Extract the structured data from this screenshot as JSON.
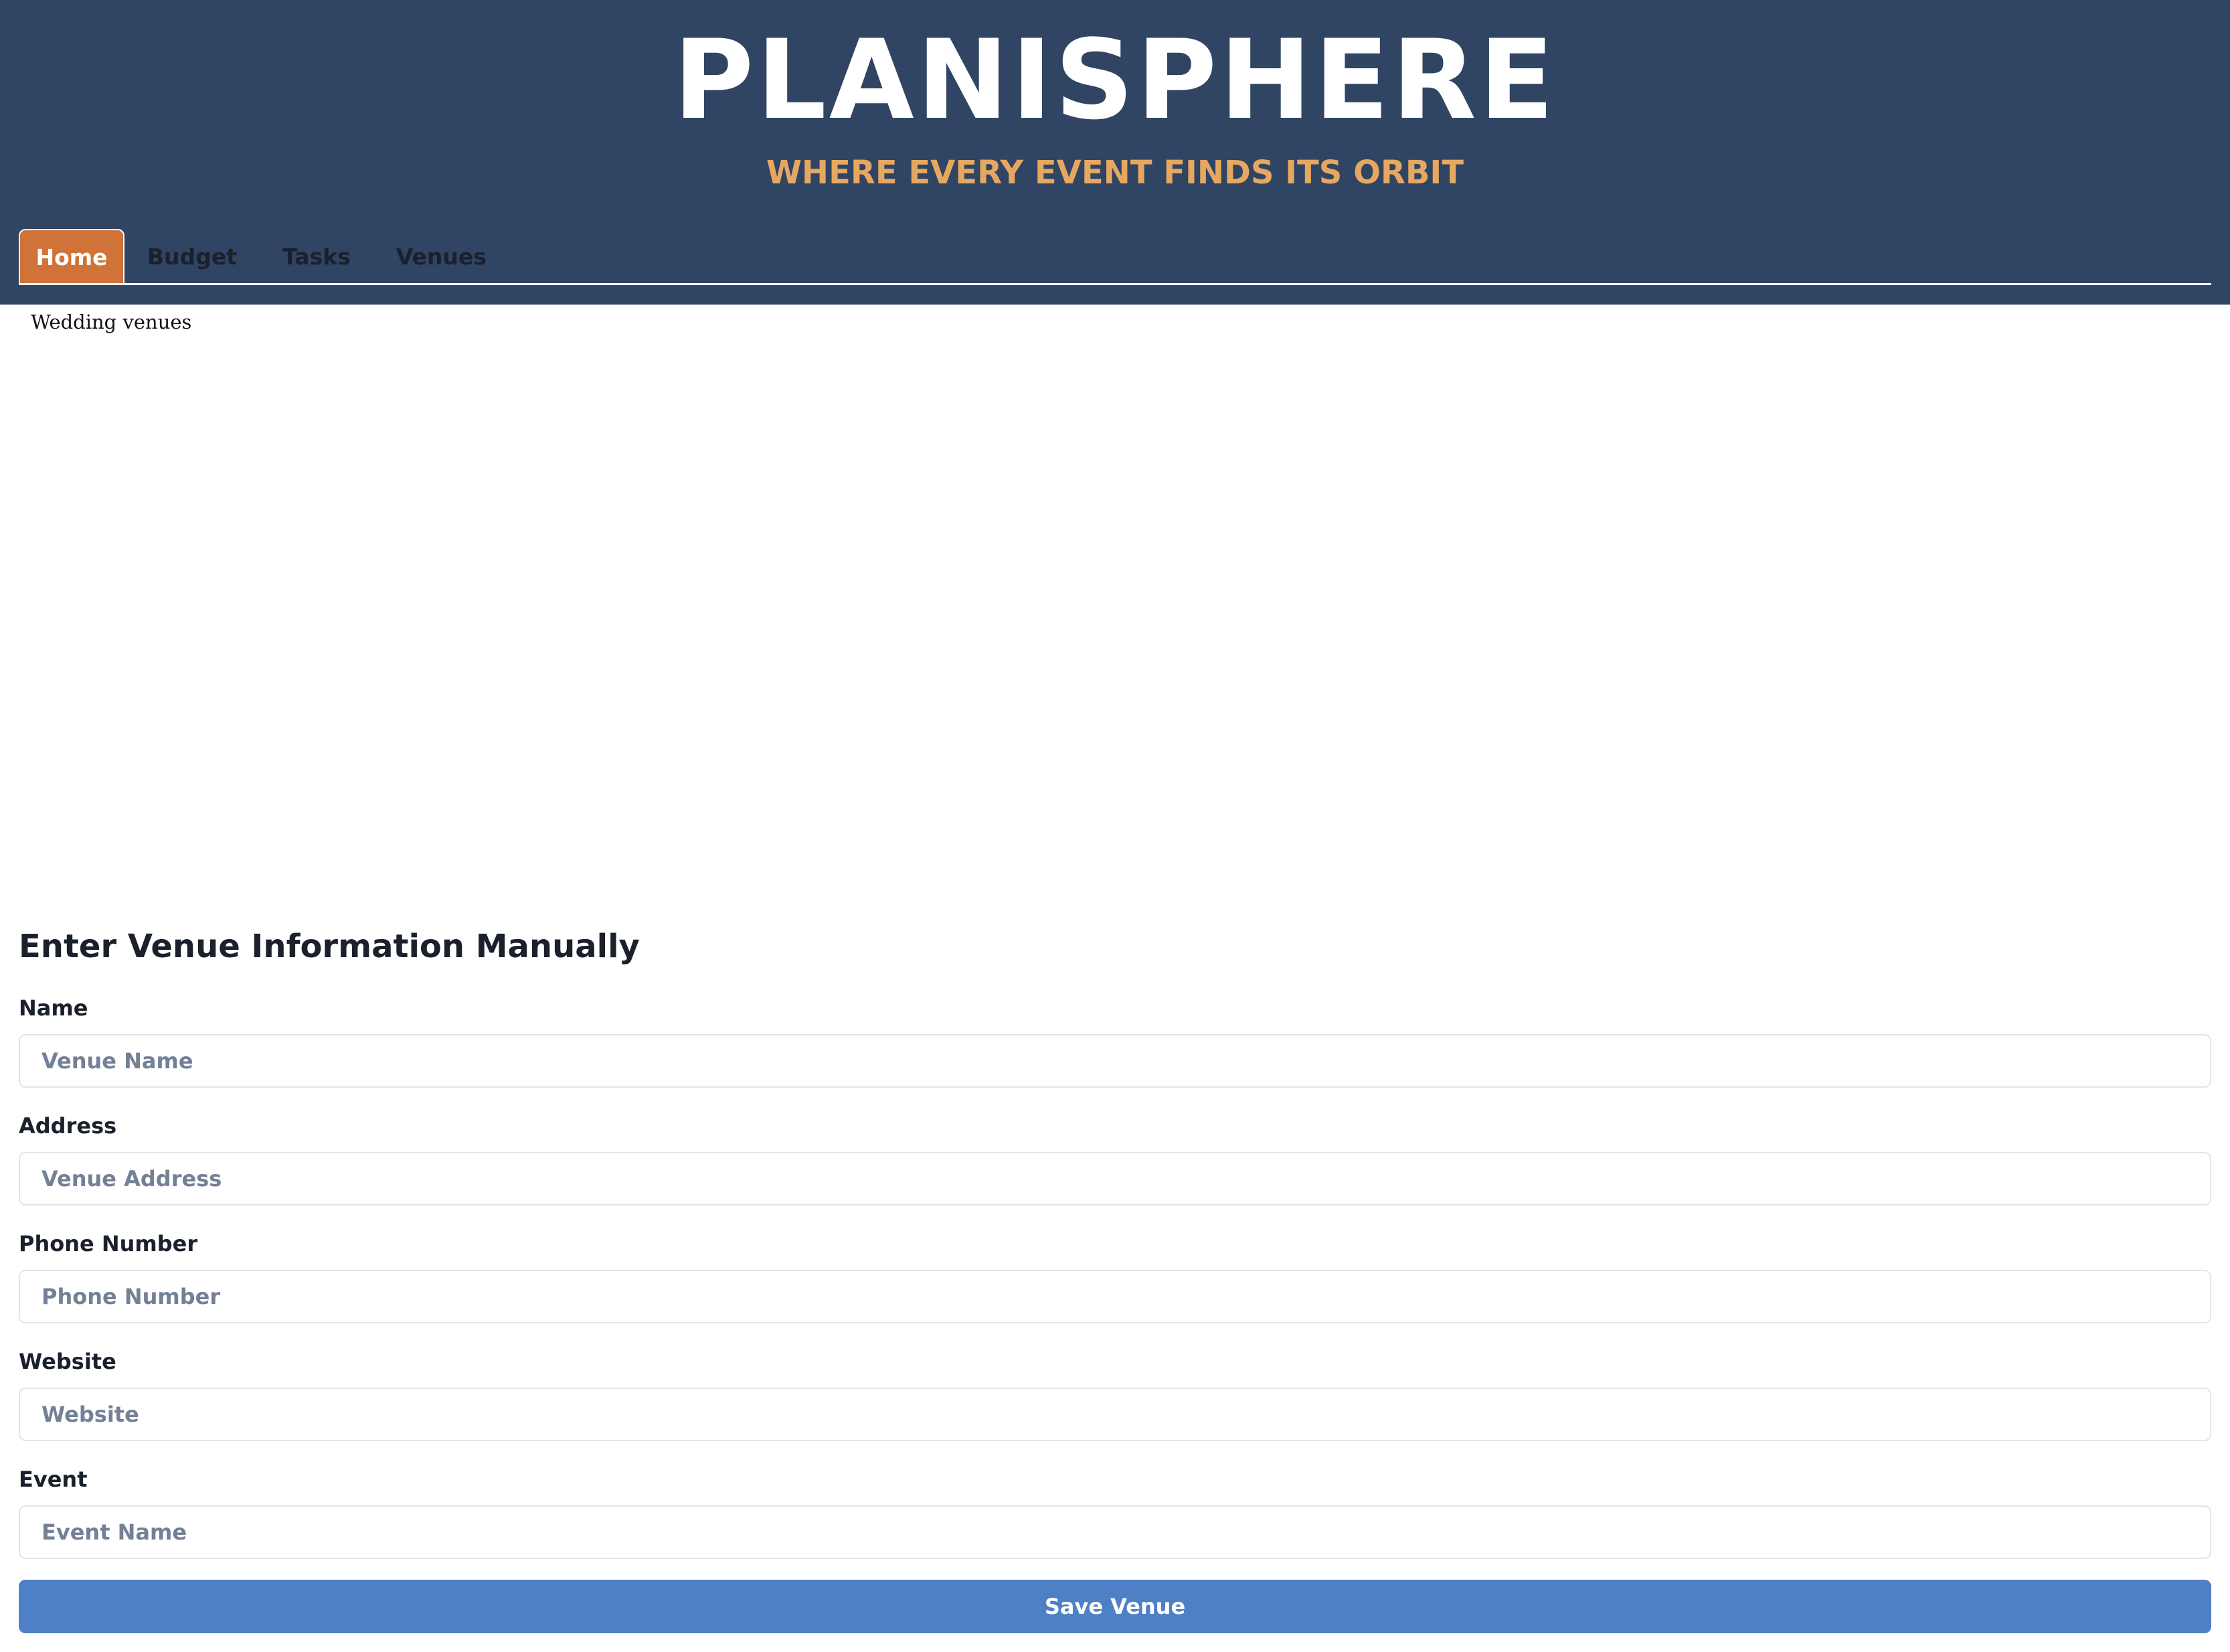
{
  "header": {
    "title": "PLANISPHERE",
    "subtitle": "WHERE EVERY EVENT FINDS ITS ORBIT"
  },
  "tabs": [
    {
      "label": "Home",
      "active": true
    },
    {
      "label": "Budget",
      "active": false
    },
    {
      "label": "Tasks",
      "active": false
    },
    {
      "label": "Venues",
      "active": false
    }
  ],
  "venues_frame": {
    "alt_text": "Wedding venues"
  },
  "form": {
    "title": "Enter Venue Information Manually",
    "fields": [
      {
        "label": "Name",
        "placeholder": "Venue Name",
        "value": ""
      },
      {
        "label": "Address",
        "placeholder": "Venue Address",
        "value": ""
      },
      {
        "label": "Phone Number",
        "placeholder": "Phone Number",
        "value": ""
      },
      {
        "label": "Website",
        "placeholder": "Website",
        "value": ""
      },
      {
        "label": "Event",
        "placeholder": "Event Name",
        "value": ""
      }
    ],
    "submit_label": "Save Venue"
  },
  "colors": {
    "header_bg": "#304463",
    "subtitle": "#e6a860",
    "active_tab": "#d07338",
    "button": "#4e80c5"
  }
}
